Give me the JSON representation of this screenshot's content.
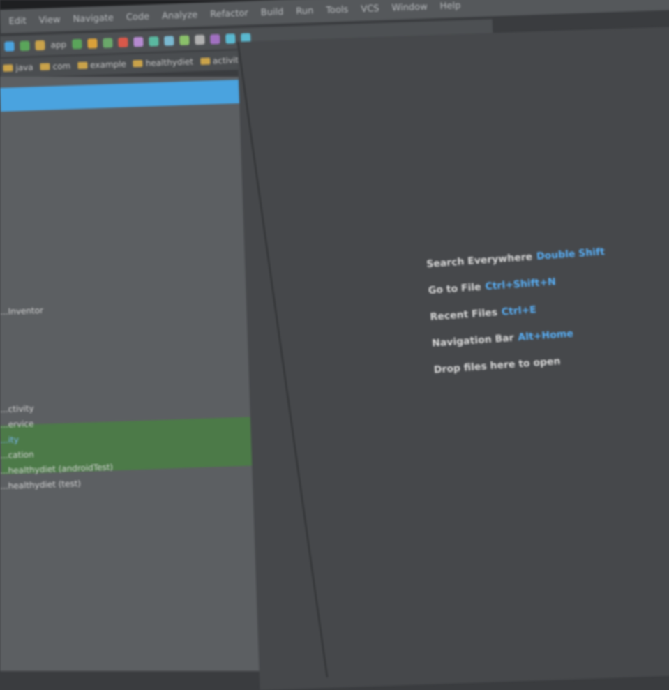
{
  "menubar": {
    "items": [
      "Edit",
      "View",
      "Navigate",
      "Code",
      "Analyze",
      "Refactor",
      "Build",
      "Run",
      "Tools",
      "VCS",
      "Window",
      "Help"
    ]
  },
  "toolbar": {
    "module": "app",
    "icons": [
      "build-icon",
      "run-icon",
      "debug-icon",
      "profile-icon",
      "sync-icon",
      "avd-icon",
      "sdk-icon"
    ]
  },
  "breadcrumb": {
    "items": [
      "java",
      "com",
      "example",
      "healthydiet",
      "activity"
    ]
  },
  "tree": {
    "items": [
      {
        "label": "...Inventor",
        "blue": false
      },
      {
        "label": "...ctivity",
        "blue": false
      },
      {
        "label": "...ervice",
        "blue": false
      },
      {
        "label": "...ity",
        "blue": true
      },
      {
        "label": "...cation",
        "blue": false
      },
      {
        "label": "...healthydiet (androidTest)",
        "blue": false
      },
      {
        "label": "...healthydiet (test)",
        "blue": false
      }
    ]
  },
  "hints": [
    {
      "label": "Search Everywhere",
      "shortcut": "Double Shift"
    },
    {
      "label": "Go to File",
      "shortcut": "Ctrl+Shift+N"
    },
    {
      "label": "Recent Files",
      "shortcut": "Ctrl+E"
    },
    {
      "label": "Navigation Bar",
      "shortcut": "Alt+Home"
    },
    {
      "label": "Drop files here to open",
      "shortcut": ""
    }
  ],
  "colors": {
    "accent": "#4aa3df",
    "shortcut": "#58aef5",
    "selection": "#4c7a48",
    "editor_bg": "#46484b",
    "panel_bg": "#5c5f62"
  }
}
